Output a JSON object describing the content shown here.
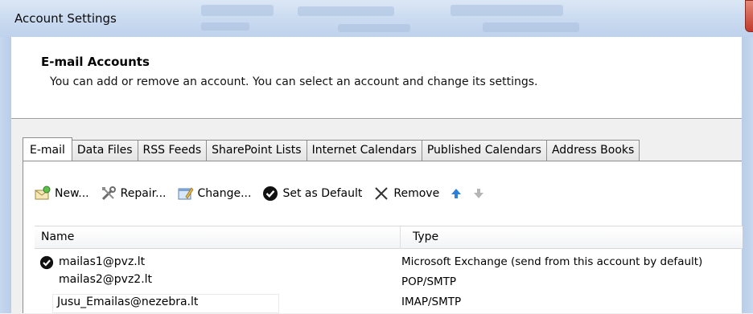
{
  "window": {
    "title": "Account Settings"
  },
  "header": {
    "title": "E-mail Accounts",
    "description": "You can add or remove an account. You can select an account and change its settings."
  },
  "tabs": [
    {
      "label": "E-mail",
      "active": true
    },
    {
      "label": "Data Files"
    },
    {
      "label": "RSS Feeds"
    },
    {
      "label": "SharePoint Lists"
    },
    {
      "label": "Internet Calendars"
    },
    {
      "label": "Published Calendars"
    },
    {
      "label": "Address Books"
    }
  ],
  "toolbar": {
    "new_label": "New...",
    "repair_label": "Repair...",
    "change_label": "Change...",
    "set_default_label": "Set as Default",
    "remove_label": "Remove"
  },
  "list": {
    "columns": {
      "name": "Name",
      "type": "Type"
    },
    "rows": [
      {
        "name": "mailas1@pvz.lt",
        "type": "Microsoft Exchange (send from this account by default)",
        "default": true
      },
      {
        "name": "mailas2@pvz2.lt",
        "type": "POP/SMTP"
      },
      {
        "name": "Jusu_Emailas@nezebra.lt",
        "type": "IMAP/SMTP",
        "selected": true
      }
    ]
  },
  "colors": {
    "accent": "#2e7fd6",
    "title_bar": "#c9daf0"
  }
}
